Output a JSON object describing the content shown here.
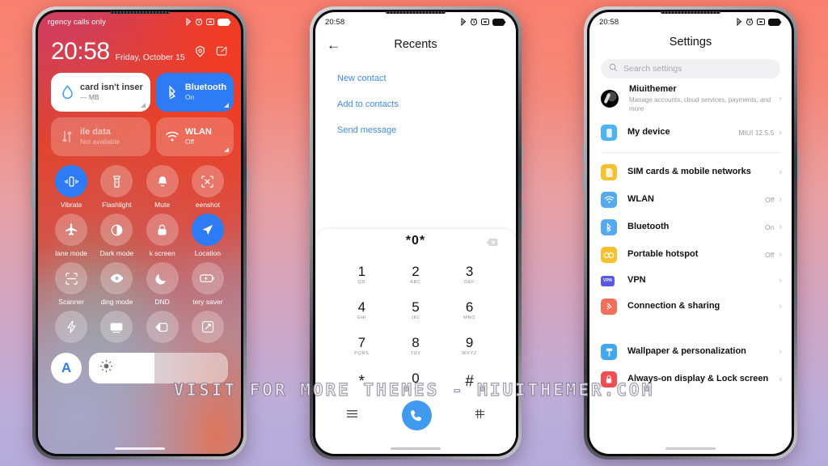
{
  "watermark": "VISIT FOR MORE THEMES - MIUITHEMER.COM",
  "theme": {
    "accent_blue": "#2e7bf6",
    "dialer_blue": "#3f9af0",
    "link_blue": "#3f8bf0",
    "bg_top": "#f9806f",
    "bg_bottom": "#b3abd9"
  },
  "phone1": {
    "statusbar": {
      "carrier": "rgency calls only",
      "icons": [
        "bluetooth-icon",
        "alarm-icon",
        "silent-icon",
        "battery-icon"
      ]
    },
    "clock": {
      "time": "20:58",
      "date": "Friday, October 15"
    },
    "clock_icons": [
      "settings-gear-icon",
      "edit-icon"
    ],
    "big_tiles": [
      {
        "title": "card isn't inser",
        "subtitle": "--- MB",
        "icon": "data-drop-icon",
        "state": "white"
      },
      {
        "title": "Bluetooth",
        "subtitle": "On",
        "icon": "bluetooth-icon",
        "state": "on"
      },
      {
        "title": "ile data",
        "subtitle": "Not available",
        "icon": "mobile-data-icon",
        "state": "disabled"
      },
      {
        "title": "WLAN",
        "subtitle": "Off",
        "icon": "wifi-icon",
        "state": "off"
      }
    ],
    "quick_tiles": [
      {
        "label": "Vibrate",
        "icon": "vibrate-icon",
        "on": true
      },
      {
        "label": "Flashlight",
        "icon": "flashlight-icon",
        "on": false
      },
      {
        "label": "Mute",
        "icon": "bell-icon",
        "on": false
      },
      {
        "label": "eenshot",
        "icon": "screenshot-icon",
        "on": false
      },
      {
        "label": "lane mode",
        "icon": "airplane-icon",
        "on": false
      },
      {
        "label": "Dark mode",
        "icon": "dark-mode-icon",
        "on": false
      },
      {
        "label": "k screen",
        "icon": "lock-icon",
        "on": false
      },
      {
        "label": "Location",
        "icon": "location-icon",
        "on": true
      },
      {
        "label": "Scanner",
        "icon": "scanner-icon",
        "on": false
      },
      {
        "label": "ding mode",
        "icon": "eye-icon",
        "on": false
      },
      {
        "label": "DND",
        "icon": "moon-icon",
        "on": false
      },
      {
        "label": "tery saver",
        "icon": "battery-saver-icon",
        "on": false
      },
      {
        "label": "",
        "icon": "lightning-icon",
        "on": false
      },
      {
        "label": "",
        "icon": "cast-screen-icon",
        "on": false
      },
      {
        "label": "",
        "icon": "reading-mode-icon",
        "on": false
      },
      {
        "label": "",
        "icon": "sync-rotate-icon",
        "on": false
      }
    ],
    "brightness": {
      "auto_label": "A",
      "icon": "sun-icon",
      "level_percent": 47
    }
  },
  "phone2": {
    "statusbar": {
      "time": "20:58",
      "icons": [
        "bluetooth-icon",
        "alarm-icon",
        "silent-icon",
        "battery-icon"
      ]
    },
    "header": {
      "back": "←",
      "title": "Recents"
    },
    "links": [
      "New contact",
      "Add to contacts",
      "Send message"
    ],
    "dialer": {
      "entry": "*0*",
      "backspace_icon": "backspace-icon",
      "keys": [
        {
          "digit": "1",
          "letters": "QD"
        },
        {
          "digit": "2",
          "letters": "ABC"
        },
        {
          "digit": "3",
          "letters": "DEF"
        },
        {
          "digit": "4",
          "letters": "GHI"
        },
        {
          "digit": "5",
          "letters": "JKL"
        },
        {
          "digit": "6",
          "letters": "MNO"
        },
        {
          "digit": "7",
          "letters": "PQRS"
        },
        {
          "digit": "8",
          "letters": "TUV"
        },
        {
          "digit": "9",
          "letters": "WXYZ"
        },
        {
          "digit": "*",
          "letters": ""
        },
        {
          "digit": "0",
          "letters": "+"
        },
        {
          "digit": "#",
          "letters": ""
        }
      ],
      "bottom": [
        "menu-icon",
        "call-button",
        "keypad-icon"
      ]
    }
  },
  "phone3": {
    "statusbar": {
      "time": "20:58",
      "icons": [
        "bluetooth-icon",
        "alarm-icon",
        "silent-icon",
        "battery-icon"
      ]
    },
    "title": "Settings",
    "search": {
      "placeholder": "Search settings",
      "icon": "search-icon"
    },
    "account": {
      "name": "Miuithemer",
      "subtitle": "Manage accounts, cloud services, payments, and more",
      "icon": "avatar"
    },
    "device": {
      "label": "My device",
      "value": "MIUI 12.5.5",
      "icon": "device-icon",
      "icon_color": "#4eb3f0"
    },
    "rows": [
      {
        "label": "SIM cards & mobile networks",
        "value": "",
        "icon": "sim-card-icon",
        "icon_color": "#f7c02e"
      },
      {
        "label": "WLAN",
        "value": "Off",
        "icon": "wifi-icon",
        "icon_color": "#55a9f0"
      },
      {
        "label": "Bluetooth",
        "value": "On",
        "icon": "bluetooth-icon",
        "icon_color": "#55a9f0"
      },
      {
        "label": "Portable hotspot",
        "value": "Off",
        "icon": "hotspot-icon",
        "icon_color": "#f7c02e"
      },
      {
        "label": "VPN",
        "value": "",
        "icon": "vpn-icon",
        "icon_color": "#5858e8"
      },
      {
        "label": "Connection & sharing",
        "value": "",
        "icon": "sharing-icon",
        "icon_color": "#f2705a"
      }
    ],
    "rows2": [
      {
        "label": "Wallpaper & personalization",
        "value": "",
        "icon": "wallpaper-icon",
        "icon_color": "#3fa8ef"
      },
      {
        "label": "Always-on display & Lock screen",
        "value": "",
        "icon": "lock-icon",
        "icon_color": "#ef4f52"
      }
    ]
  }
}
